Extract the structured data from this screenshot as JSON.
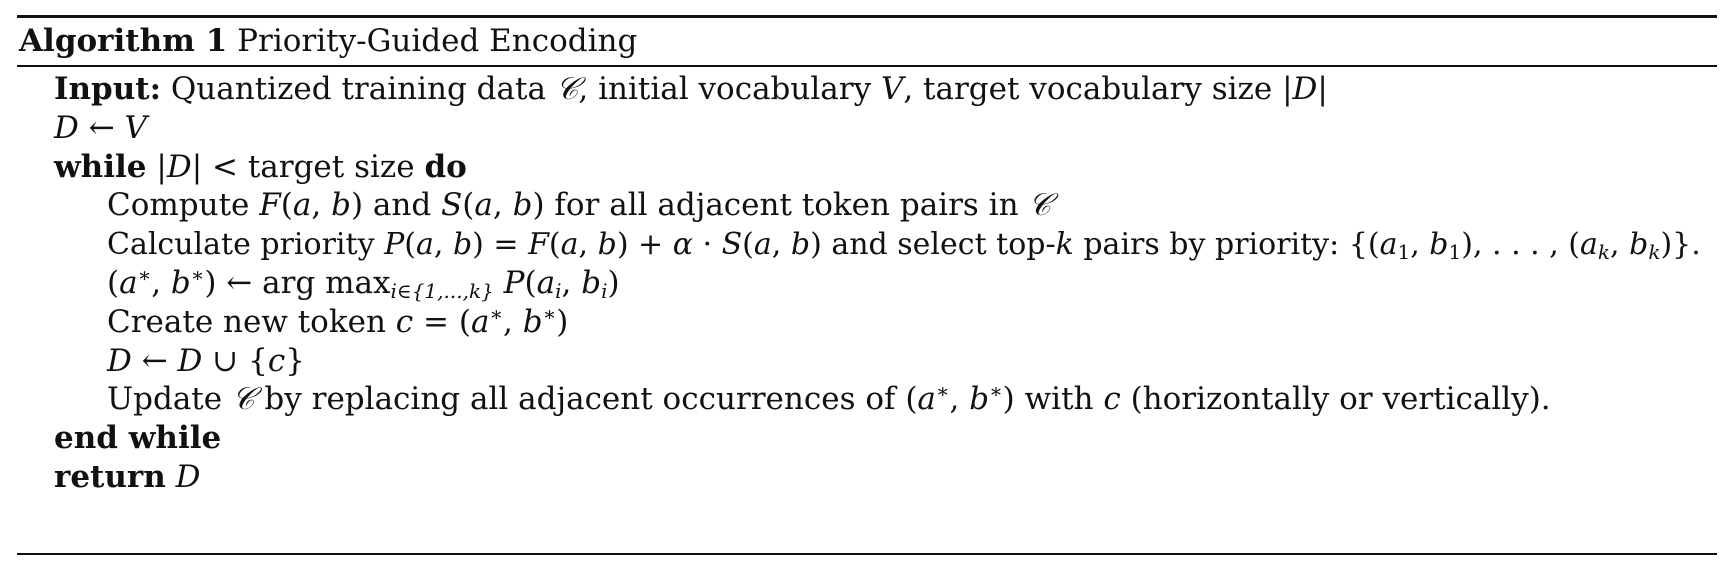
{
  "algorithm": {
    "label": "Algorithm 1",
    "title": "Priority-Guided Encoding"
  },
  "lines": [
    {
      "keyword": "Input:",
      "segments": [
        {
          "t": " Quantized training data ",
          "s": "text"
        },
        {
          "t": "𝒞",
          "s": "math"
        },
        {
          "t": ", initial vocabulary ",
          "s": "text"
        },
        {
          "t": "V",
          "s": "math"
        },
        {
          "t": ", target vocabulary size |",
          "s": "text"
        },
        {
          "t": "D",
          "s": "math"
        },
        {
          "t": "|",
          "s": "text"
        }
      ]
    },
    {
      "segments": [
        {
          "t": "D",
          "s": "math"
        },
        {
          "t": " ← ",
          "s": "text"
        },
        {
          "t": "V",
          "s": "math"
        }
      ]
    },
    {
      "keyword": "while",
      "segments": [
        {
          "t": " |",
          "s": "text"
        },
        {
          "t": "D",
          "s": "math"
        },
        {
          "t": "| < target size ",
          "s": "text"
        }
      ],
      "keyword_end": "do"
    },
    {
      "indent": 1,
      "segments": [
        {
          "t": "Compute ",
          "s": "text"
        },
        {
          "t": "F",
          "s": "math"
        },
        {
          "t": "(",
          "s": "text"
        },
        {
          "t": "a",
          "s": "math"
        },
        {
          "t": ", ",
          "s": "text"
        },
        {
          "t": "b",
          "s": "math"
        },
        {
          "t": ") and ",
          "s": "text"
        },
        {
          "t": "S",
          "s": "math"
        },
        {
          "t": "(",
          "s": "text"
        },
        {
          "t": "a",
          "s": "math"
        },
        {
          "t": ", ",
          "s": "text"
        },
        {
          "t": "b",
          "s": "math"
        },
        {
          "t": ") for all adjacent token pairs in ",
          "s": "text"
        },
        {
          "t": "𝒞",
          "s": "math"
        }
      ]
    },
    {
      "indent": 1,
      "segments": [
        {
          "t": "Calculate priority ",
          "s": "text"
        },
        {
          "t": "P",
          "s": "math"
        },
        {
          "t": "(",
          "s": "text"
        },
        {
          "t": "a",
          "s": "math"
        },
        {
          "t": ", ",
          "s": "text"
        },
        {
          "t": "b",
          "s": "math"
        },
        {
          "t": ") = ",
          "s": "text"
        },
        {
          "t": "F",
          "s": "math"
        },
        {
          "t": "(",
          "s": "text"
        },
        {
          "t": "a",
          "s": "math"
        },
        {
          "t": ", ",
          "s": "text"
        },
        {
          "t": "b",
          "s": "math"
        },
        {
          "t": ") + ",
          "s": "text"
        },
        {
          "t": "α",
          "s": "math"
        },
        {
          "t": " · ",
          "s": "text"
        },
        {
          "t": "S",
          "s": "math"
        },
        {
          "t": "(",
          "s": "text"
        },
        {
          "t": "a",
          "s": "math"
        },
        {
          "t": ", ",
          "s": "text"
        },
        {
          "t": "b",
          "s": "math"
        },
        {
          "t": ") and select top-",
          "s": "text"
        },
        {
          "t": "k",
          "s": "math"
        },
        {
          "t": " pairs by priority: {(",
          "s": "text"
        },
        {
          "t": "a",
          "s": "math"
        },
        {
          "t": "1",
          "s": "sub"
        },
        {
          "t": ", ",
          "s": "text"
        },
        {
          "t": "b",
          "s": "math"
        },
        {
          "t": "1",
          "s": "sub"
        },
        {
          "t": "), . . . , (",
          "s": "text"
        },
        {
          "t": "a",
          "s": "math"
        },
        {
          "t": "k",
          "s": "sub-math"
        },
        {
          "t": ", ",
          "s": "text"
        },
        {
          "t": "b",
          "s": "math"
        },
        {
          "t": "k",
          "s": "sub-math"
        },
        {
          "t": ")}.",
          "s": "text"
        }
      ]
    },
    {
      "indent": 1,
      "segments": [
        {
          "t": "(",
          "s": "text"
        },
        {
          "t": "a",
          "s": "math"
        },
        {
          "t": "∗",
          "s": "sup"
        },
        {
          "t": ", ",
          "s": "text"
        },
        {
          "t": "b",
          "s": "math"
        },
        {
          "t": "∗",
          "s": "sup"
        },
        {
          "t": ") ← arg max",
          "s": "text"
        },
        {
          "t": "i∈{1,...,k}",
          "s": "sub-math"
        },
        {
          "t": " ",
          "s": "text"
        },
        {
          "t": "P",
          "s": "math"
        },
        {
          "t": "(",
          "s": "text"
        },
        {
          "t": "a",
          "s": "math"
        },
        {
          "t": "i",
          "s": "sub-math"
        },
        {
          "t": ", ",
          "s": "text"
        },
        {
          "t": "b",
          "s": "math"
        },
        {
          "t": "i",
          "s": "sub-math"
        },
        {
          "t": ")",
          "s": "text"
        }
      ]
    },
    {
      "indent": 1,
      "segments": [
        {
          "t": "Create new token ",
          "s": "text"
        },
        {
          "t": "c",
          "s": "math"
        },
        {
          "t": " = (",
          "s": "text"
        },
        {
          "t": "a",
          "s": "math"
        },
        {
          "t": "∗",
          "s": "sup"
        },
        {
          "t": ", ",
          "s": "text"
        },
        {
          "t": "b",
          "s": "math"
        },
        {
          "t": "∗",
          "s": "sup"
        },
        {
          "t": ")",
          "s": "text"
        }
      ]
    },
    {
      "indent": 1,
      "segments": [
        {
          "t": "D",
          "s": "math"
        },
        {
          "t": " ← ",
          "s": "text"
        },
        {
          "t": "D",
          "s": "math"
        },
        {
          "t": " ∪ {",
          "s": "text"
        },
        {
          "t": "c",
          "s": "math"
        },
        {
          "t": "}",
          "s": "text"
        }
      ]
    },
    {
      "indent": 1,
      "segments": [
        {
          "t": "Update ",
          "s": "text"
        },
        {
          "t": "𝒞",
          "s": "math"
        },
        {
          "t": " by replacing all adjacent occurrences of (",
          "s": "text"
        },
        {
          "t": "a",
          "s": "math"
        },
        {
          "t": "∗",
          "s": "sup"
        },
        {
          "t": ", ",
          "s": "text"
        },
        {
          "t": "b",
          "s": "math"
        },
        {
          "t": "∗",
          "s": "sup"
        },
        {
          "t": ") with ",
          "s": "text"
        },
        {
          "t": "c",
          "s": "math"
        },
        {
          "t": " (horizontally or vertically).",
          "s": "text"
        }
      ]
    },
    {
      "keyword": "end while",
      "segments": []
    },
    {
      "keyword": "return",
      "segments": [
        {
          "t": " ",
          "s": "text"
        },
        {
          "t": "D",
          "s": "math"
        }
      ]
    }
  ]
}
